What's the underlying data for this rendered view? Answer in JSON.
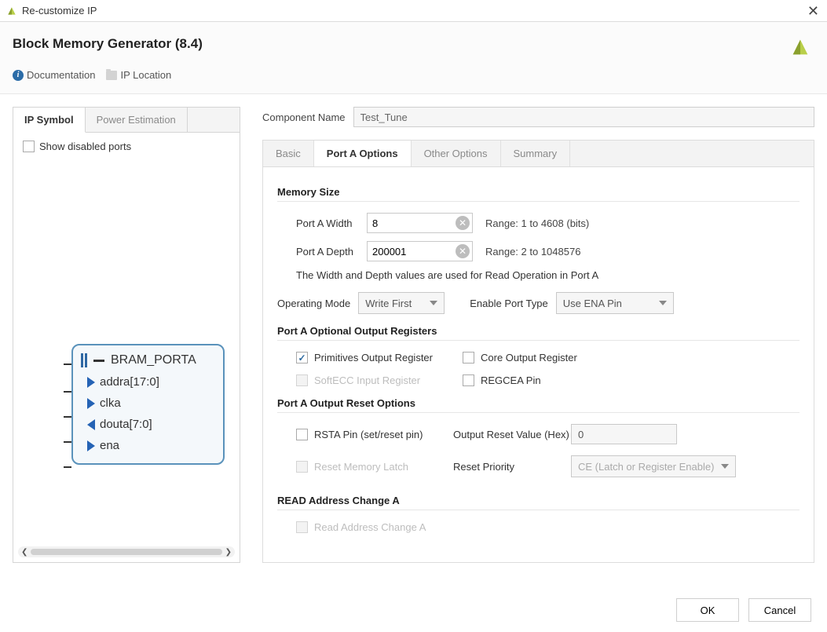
{
  "window": {
    "title": "Re-customize IP"
  },
  "header": {
    "title": "Block Memory Generator (8.4)",
    "documentation_label": "Documentation",
    "ip_location_label": "IP Location"
  },
  "left_panel": {
    "tabs": [
      "IP Symbol",
      "Power Estimation"
    ],
    "active_tab_index": 0,
    "show_disabled_ports_label": "Show disabled ports",
    "diagram": {
      "block_title": "BRAM_PORTA",
      "ports": [
        {
          "label": "addra[17:0]",
          "direction": "in"
        },
        {
          "label": "clka",
          "direction": "in"
        },
        {
          "label": "douta[7:0]",
          "direction": "out"
        },
        {
          "label": "ena",
          "direction": "in"
        }
      ]
    }
  },
  "component_name": {
    "label": "Component Name",
    "value": "Test_Tune"
  },
  "right_panel": {
    "tabs": [
      "Basic",
      "Port A Options",
      "Other Options",
      "Summary"
    ],
    "active_tab_index": 1,
    "memory_size": {
      "title": "Memory Size",
      "width_label": "Port A Width",
      "width_value": "8",
      "width_range": "Range: 1 to 4608 (bits)",
      "depth_label": "Port A Depth",
      "depth_value": "200001",
      "depth_range": "Range: 2 to 1048576",
      "note": "The Width and Depth values are used for Read Operation in Port A"
    },
    "operating_mode": {
      "label": "Operating Mode",
      "value": "Write First"
    },
    "enable_port_type": {
      "label": "Enable Port Type",
      "value": "Use ENA Pin"
    },
    "output_registers": {
      "title": "Port A Optional Output Registers",
      "primitives_label": "Primitives Output Register",
      "primitives_checked": true,
      "core_label": "Core Output Register",
      "core_checked": false,
      "softecc_label": "SoftECC Input Register",
      "softecc_checked": false,
      "softecc_disabled": true,
      "regcea_label": "REGCEA Pin",
      "regcea_checked": false
    },
    "output_reset": {
      "title": "Port A Output Reset Options",
      "rsta_label": "RSTA Pin (set/reset pin)",
      "rsta_checked": false,
      "rv_label": "Output Reset Value (Hex)",
      "rv_value": "0",
      "rml_label": "Reset Memory Latch",
      "rml_checked": false,
      "rml_disabled": true,
      "rp_label": "Reset Priority",
      "rp_value": "CE (Latch or Register Enable)",
      "rp_disabled": true
    },
    "read_addr": {
      "title": "READ Address Change A",
      "chk_label": "Read Address Change A",
      "chk_checked": false,
      "chk_disabled": true
    }
  },
  "footer": {
    "ok": "OK",
    "cancel": "Cancel"
  }
}
